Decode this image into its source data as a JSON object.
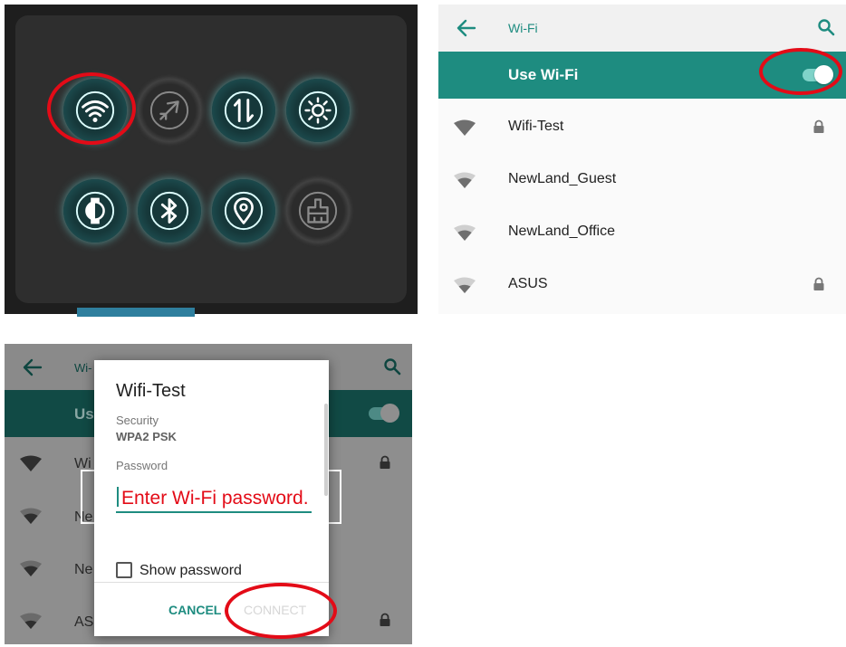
{
  "colors": {
    "accent": "#1e8c80",
    "annotation": "#e30b17",
    "tile_glow": "#6fe6e6"
  },
  "quick_settings": {
    "tiles": [
      {
        "icon": "wifi-icon",
        "state": "on"
      },
      {
        "icon": "airplane-icon",
        "state": "off"
      },
      {
        "icon": "mobile-data-icon",
        "state": "on"
      },
      {
        "icon": "brightness-icon",
        "state": "on"
      },
      {
        "icon": "auto-rotate-icon",
        "state": "on"
      },
      {
        "icon": "bluetooth-icon",
        "state": "on"
      },
      {
        "icon": "location-icon",
        "state": "on"
      },
      {
        "icon": "cleaner-icon",
        "state": "off"
      }
    ]
  },
  "wifi_screen": {
    "title": "Wi-Fi",
    "toggle_label": "Use Wi-Fi",
    "toggle_on": true,
    "networks": [
      {
        "name": "Wifi-Test",
        "secured": true
      },
      {
        "name": "NewLand_Guest",
        "secured": false
      },
      {
        "name": "NewLand_Office",
        "secured": false
      },
      {
        "name": "ASUS",
        "secured": true
      }
    ]
  },
  "dialog_screen": {
    "title_fragment": "Wi-",
    "toggle_fragment": "Us",
    "network_fragments": [
      "Wi",
      "Ne",
      "Ne",
      "AS"
    ],
    "dialog": {
      "title": "Wifi-Test",
      "security_label": "Security",
      "security_value": "WPA2 PSK",
      "password_label": "Password",
      "password_hint": "Enter Wi-Fi password.",
      "show_password_label": "Show password",
      "cancel_label": "CANCEL",
      "connect_label": "CONNECT"
    }
  }
}
